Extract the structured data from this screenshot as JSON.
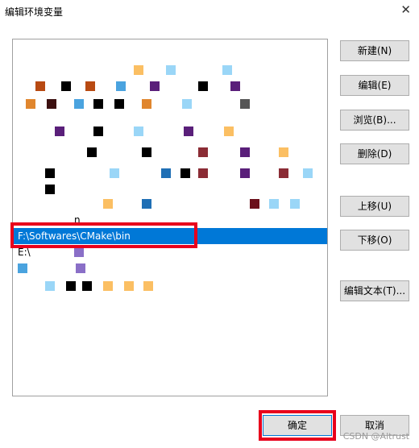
{
  "window": {
    "title": "编辑环境变量",
    "close_glyph": "✕"
  },
  "list": {
    "selected_item": "F:\\Softwares\\CMake\\bin",
    "visible_fragments": {
      "row11": "n",
      "row14": "E:\\"
    }
  },
  "buttons": {
    "new": "新建(N)",
    "edit": "编辑(E)",
    "browse": "浏览(B)...",
    "delete": "删除(D)",
    "move_up": "上移(U)",
    "move_down": "下移(O)",
    "edit_text": "编辑文本(T)...",
    "ok": "确定",
    "cancel": "取消"
  },
  "watermark": "CSDN @Altrust",
  "colors": {
    "selection": "#0078d7",
    "highlight_border": "#e8001c"
  }
}
